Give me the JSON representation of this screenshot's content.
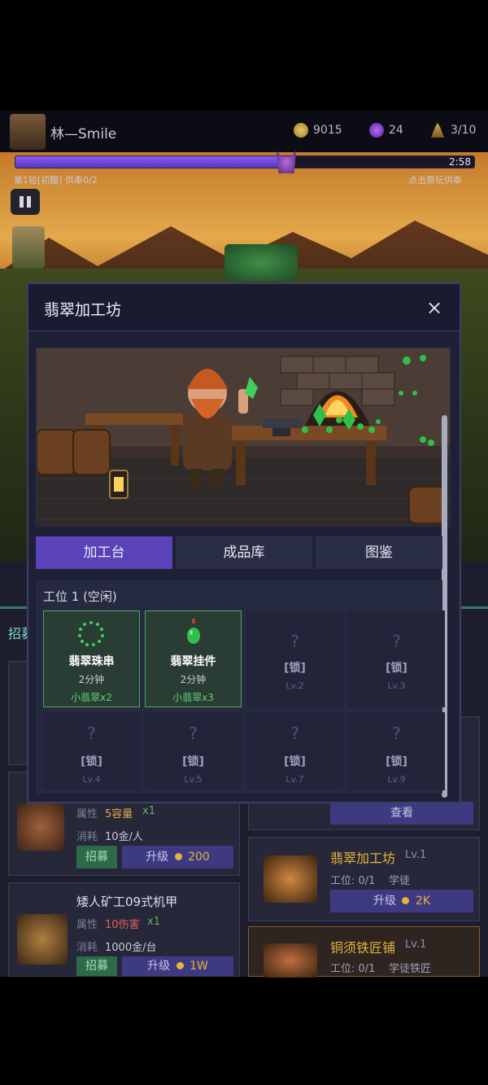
{
  "hud": {
    "player_name": "林—Smile",
    "coins": "9015",
    "gems": "24",
    "workers": "3/10",
    "timer": "2:58",
    "round_info": "第1轮[初醒] 供奉0/2",
    "altar_hint": "点击祭坛供奉",
    "progress": 0.59
  },
  "background": {
    "partial_recruit_label": "招募",
    "card1": {
      "attr_label": "属性",
      "attr_value": "5容量",
      "attr_mult": "x1",
      "cost_label": "消耗",
      "cost_value": "10金/人",
      "recruit_btn": "招募",
      "upgrade_btn": "升级",
      "upgrade_cost": "200"
    },
    "card2": {
      "title": "矮人矿工09式机甲",
      "attr_label": "属性",
      "attr_value": "10伤害",
      "attr_mult": "x1",
      "cost_label": "消耗",
      "cost_value": "1000金/台",
      "recruit_btn": "招募",
      "upgrade_btn": "升级",
      "upgrade_cost": "1W"
    },
    "view_btn": "查看",
    "building1": {
      "name": "翡翠加工坊",
      "level": "Lv.1",
      "slots_label": "工位: 0/1",
      "role": "学徒",
      "upgrade_btn": "升级",
      "upgrade_cost": "2K"
    },
    "building2": {
      "name": "铜须铁匠铺",
      "level": "Lv.1",
      "slots_label": "工位: 0/1",
      "role": "学徒铁匠"
    }
  },
  "modal": {
    "title": "翡翠加工坊",
    "close": "×",
    "tabs": [
      "加工台",
      "成品库",
      "图鉴"
    ],
    "slot_title": "工位 1 (空闲)",
    "recipes": [
      {
        "name": "翡翠珠串",
        "time": "2分钟",
        "cost": "小翡翠x2",
        "icon": "bead-string-icon"
      },
      {
        "name": "翡翠挂件",
        "time": "2分钟",
        "cost": "小翡翠x3",
        "icon": "pendant-icon"
      }
    ],
    "locked": [
      {
        "mark": "?",
        "label": "[锁]",
        "level": "Lv.2"
      },
      {
        "mark": "?",
        "label": "[锁]",
        "level": "Lv.3"
      },
      {
        "mark": "?",
        "label": "[锁]",
        "level": "Lv.4"
      },
      {
        "mark": "?",
        "label": "[锁]",
        "level": "Lv.5"
      },
      {
        "mark": "?",
        "label": "[锁]",
        "level": "Lv.7"
      },
      {
        "mark": "?",
        "label": "[锁]",
        "level": "Lv.9"
      }
    ]
  },
  "colors": {
    "accent": "#5a43b8",
    "active_green": "#4aa860",
    "gold": "#e2b43c"
  }
}
